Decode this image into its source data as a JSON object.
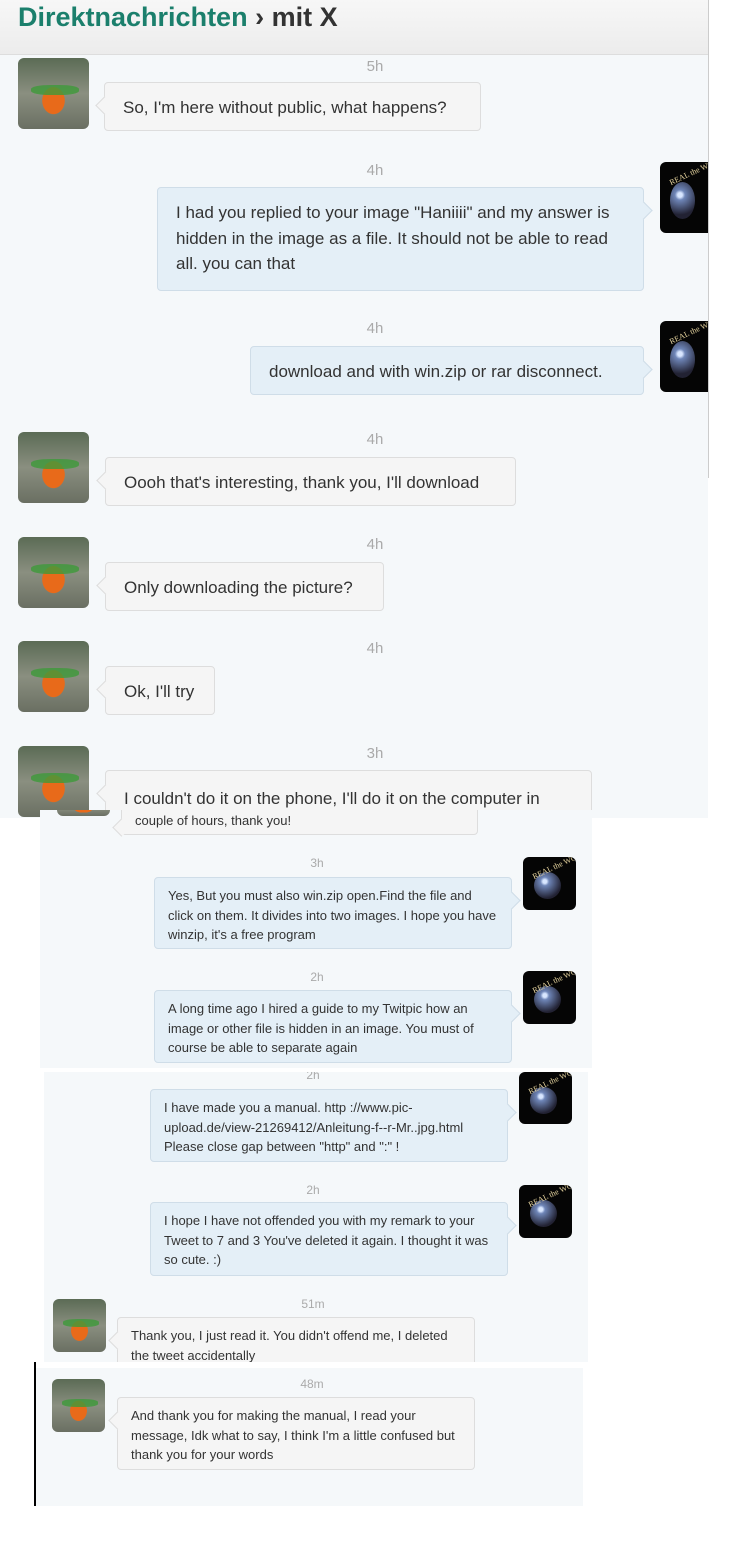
{
  "header": {
    "title_link": "Direktnachrichten",
    "title_rest": "› mit X"
  },
  "messages": [
    {
      "time": "5h",
      "text": "So, I'm here without public, what happens?"
    },
    {
      "time": "4h",
      "text": "I had you replied to your image \"Haniiii\" and my answer is hidden in the image as a file. It should not be able to read all. you can that"
    },
    {
      "time": "4h",
      "text": "download and with win.zip or rar disconnect."
    },
    {
      "time": "4h",
      "text": "Oooh that's interesting, thank you, I'll download"
    },
    {
      "time": "4h",
      "text": "Only downloading the picture?"
    },
    {
      "time": "4h",
      "text": "Ok, I'll try"
    },
    {
      "time": "3h",
      "text": "I couldn't do it on the phone, I'll do it on the computer in"
    },
    {
      "time": "",
      "text": "couple of hours, thank you!"
    },
    {
      "time": "3h",
      "text": "Yes, But you must also win.zip open.Find the file and click on them. It divides into two images. I hope you have winzip, it's a free program"
    },
    {
      "time": "2h",
      "text": "A long time ago I hired a guide to my Twitpic how an image or other file is hidden in an image. You must of course be able to separate again"
    },
    {
      "time": "2h",
      "text": "I have made you a manual. http ://www.pic-upload.de/view-21269412/Anleitung-f--r-Mr..jpg.html Please close gap between \"http\" and \":\" !"
    },
    {
      "time": "2h",
      "text": "I hope I have not offended you with my remark to your Tweet to 7 and 3 You've deleted it again. I thought it was so cute. :)"
    },
    {
      "time": "51m",
      "text": "Thank you, I just read it. You didn't offend me, I deleted the tweet accidentally"
    },
    {
      "time": "48m",
      "text": "And thank you for making the manual, I read your message, Idk what to say, I think I'm a little confused but thank you for your words"
    }
  ],
  "colors": {
    "header_link": "#1b7f6c",
    "panel_bg": "#f5f8fa",
    "my_bubble": "#e4eff7",
    "their_bubble": "#f5f5f5"
  },
  "avatars": {
    "them": "graffiti-avatar",
    "me": "real-the-world-avatar"
  }
}
